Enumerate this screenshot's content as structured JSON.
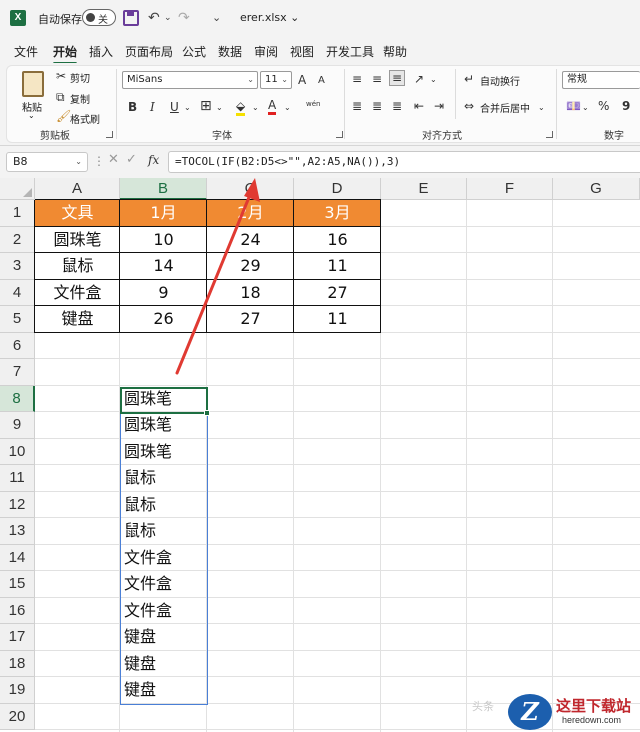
{
  "titlebar": {
    "autosave_label": "自动保存",
    "toggle_text": "关",
    "filename": "erer.xlsx",
    "app_logo": "X"
  },
  "menu": [
    "文件",
    "开始",
    "插入",
    "页面布局",
    "公式",
    "数据",
    "审阅",
    "视图",
    "开发工具",
    "帮助"
  ],
  "menu_active_index": 1,
  "ribbon": {
    "clipboard": {
      "paste": "粘贴",
      "cut": "剪切",
      "copy": "复制",
      "format_painter": "格式刷",
      "group_label": "剪贴板"
    },
    "font": {
      "name": "MiSans",
      "size": "11",
      "bold": "B",
      "italic": "I",
      "underline": "U",
      "grow": "A",
      "shrink": "A",
      "font_color_glyph": "A",
      "wen": "wén",
      "group_label": "字体"
    },
    "alignment": {
      "wrap": "自动换行",
      "merge": "合并后居中",
      "group_label": "对齐方式"
    },
    "number": {
      "format": "常规",
      "percent": "%",
      "comma": "9",
      "group_label": "数字"
    }
  },
  "formula_bar": {
    "name_box": "B8",
    "fx": "fx",
    "formula": "=TOCOL(IF(B2:D5<>\"\",A2:A5,NA()),3)"
  },
  "grid": {
    "columns": [
      "A",
      "B",
      "C",
      "D",
      "E",
      "F",
      "G"
    ],
    "selected_column": "B",
    "rows": [
      "1",
      "2",
      "3",
      "4",
      "5",
      "6",
      "7",
      "8",
      "9",
      "10",
      "11",
      "12",
      "13",
      "14",
      "15",
      "16",
      "17",
      "18",
      "19",
      "20"
    ],
    "selected_row": "8",
    "table_header": [
      "文具",
      "1月",
      "2月",
      "3月"
    ],
    "table_rows": [
      [
        "圆珠笔",
        "10",
        "24",
        "16"
      ],
      [
        "鼠标",
        "14",
        "29",
        "11"
      ],
      [
        "文件盒",
        "9",
        "18",
        "27"
      ],
      [
        "键盘",
        "26",
        "27",
        "11"
      ]
    ],
    "spill_values": [
      "圆珠笔",
      "圆珠笔",
      "圆珠笔",
      "鼠标",
      "鼠标",
      "鼠标",
      "文件盒",
      "文件盒",
      "文件盒",
      "键盘",
      "键盘",
      "键盘"
    ]
  },
  "watermark": {
    "title": "这里下载站",
    "subtitle": "heredown.com",
    "logo_letter": "Z",
    "faded": "头条"
  },
  "colors": {
    "header_fill": "#f08a32",
    "accent": "#1d6f42",
    "arrow": "#e03a32",
    "spill_border": "#4a7fd6"
  }
}
